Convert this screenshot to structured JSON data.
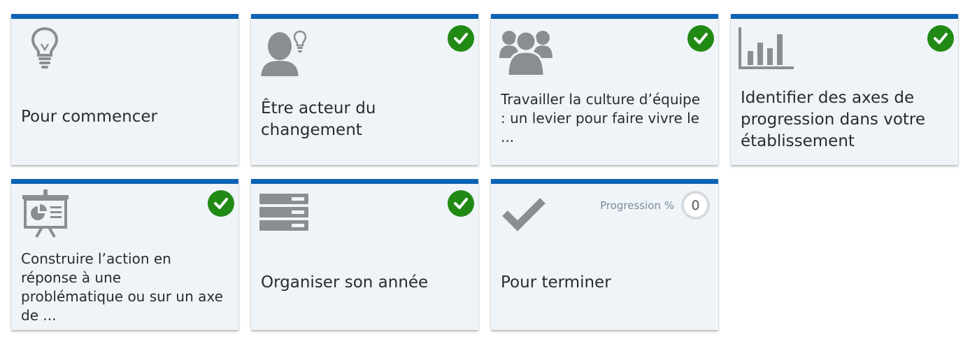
{
  "colors": {
    "accent_bar": "#0d63b4",
    "tile_background": "#eff4f9",
    "check_badge": "#218a15",
    "icon_gray": "#8b8e91"
  },
  "tiles": [
    {
      "title": "Pour commencer",
      "icon": "lightbulb-icon",
      "completed": false
    },
    {
      "title": "Être acteur du changement",
      "icon": "person-idea-icon",
      "completed": true
    },
    {
      "title": "Travailler la culture d’équipe : un levier pour faire vivre le ...",
      "icon": "team-icon",
      "completed": true
    },
    {
      "title": "Identifier des axes de progression dans votre établissement",
      "icon": "bar-chart-icon",
      "completed": true
    },
    {
      "title": "Construire l’action en réponse à une problématique ou sur un axe de ...",
      "icon": "presentation-board-icon",
      "completed": true
    },
    {
      "title": "Organiser son année",
      "icon": "server-stack-icon",
      "completed": true
    },
    {
      "title": "Pour terminer",
      "icon": "checkmark-icon",
      "completed": false,
      "progress_label": "Progression %",
      "progress_value": "0"
    }
  ]
}
